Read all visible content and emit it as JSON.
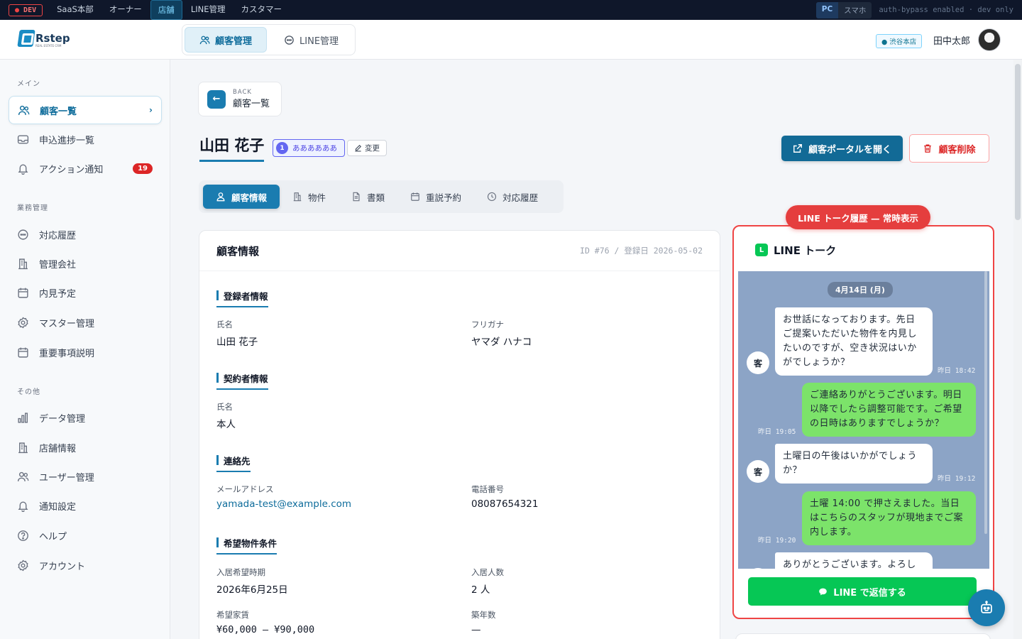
{
  "devbar": {
    "env": "DEV",
    "nav": [
      "SaaS本部",
      "オーナー",
      "店舗",
      "LINE管理",
      "カスタマー"
    ],
    "active_nav": "店舗",
    "view_pc": "PC",
    "view_sp": "スマホ",
    "note": "auth-bypass enabled · dev only"
  },
  "header": {
    "logo": "Rstep",
    "logo_sub": "REAL ESTATE CRM",
    "tabs": [
      "顧客管理",
      "LINE管理"
    ],
    "store": "● 渋谷本店",
    "user": "田中太郎"
  },
  "sidebar": {
    "sections": [
      "メイン",
      "業務管理",
      "その他"
    ],
    "main_items": [
      {
        "label": "顧客一覧",
        "icon": "users-icon"
      },
      {
        "label": "申込進捗一覧",
        "icon": "inbox-icon"
      },
      {
        "label": "アクション通知",
        "icon": "bell-icon",
        "badge": "19"
      }
    ],
    "work_items": [
      {
        "label": "対応履歴",
        "icon": "chat-icon"
      },
      {
        "label": "管理会社",
        "icon": "building-icon"
      },
      {
        "label": "内見予定",
        "icon": "calendar-icon"
      },
      {
        "label": "マスター管理",
        "icon": "gear-icon"
      },
      {
        "label": "重要事項説明",
        "icon": "calendar-icon"
      }
    ],
    "other_items": [
      {
        "label": "データ管理",
        "icon": "bar-chart-icon"
      },
      {
        "label": "店舗情報",
        "icon": "building-icon"
      },
      {
        "label": "ユーザー管理",
        "icon": "users-icon"
      },
      {
        "label": "通知設定",
        "icon": "bell-icon"
      },
      {
        "label": "ヘルプ",
        "icon": "help-icon"
      },
      {
        "label": "アカウント",
        "icon": "gear-icon"
      }
    ]
  },
  "back": {
    "small": "BACK",
    "label": "顧客一覧"
  },
  "customer": {
    "name": "山田 花子",
    "rank_num": "1",
    "rank_label": "ああああああ",
    "change_label": "変更",
    "portal_button": "顧客ポータルを開く",
    "delete_button": "顧客削除"
  },
  "tabs": [
    "顧客情報",
    "物件",
    "書類",
    "重説予約",
    "対応履歴"
  ],
  "card": {
    "title": "顧客情報",
    "meta": "ID #76 / 登録日 2026-05-02",
    "registrant": {
      "heading": "登録者情報",
      "name_label": "氏名",
      "name": "山田 花子",
      "kana_label": "フリガナ",
      "kana": "ヤマダ ハナコ"
    },
    "contractor": {
      "heading": "契約者情報",
      "name_label": "氏名",
      "name": "本人"
    },
    "contact": {
      "heading": "連絡先",
      "email_label": "メールアドレス",
      "email": "yamada-test@example.com",
      "phone_label": "電話番号",
      "phone": "08087654321"
    },
    "wish": {
      "heading": "希望物件条件",
      "move_label": "入居希望時期",
      "move": "2026年6月25日",
      "people_label": "入居人数",
      "people": "2 人",
      "rent_label": "希望家賃",
      "rent": "¥60,000 — ¥90,000",
      "age_label": "築年数",
      "age": "—"
    }
  },
  "line": {
    "callout": "LINE トーク履歴 — 常時表示",
    "logo": "L",
    "title": "LINE トーク",
    "date": "4月14日 (月)",
    "avatar": "客",
    "messages": [
      {
        "dir": "in",
        "text": "お世話になっております。先日ご提案いただいた物件を内見したいのですが、空き状況はいかがでしょうか？",
        "time": "昨日 18:42"
      },
      {
        "dir": "out",
        "text": "ご連絡ありがとうございます。明日以降でしたら調整可能です。ご希望の日時はありますでしょうか？",
        "time": "昨日 19:05"
      },
      {
        "dir": "in",
        "text": "土曜日の午後はいかがでしょうか？",
        "time": "昨日 19:12"
      },
      {
        "dir": "out",
        "text": "土曜 14:00 で押さえました。当日はこちらのスタッフが現地までご案内します。",
        "time": "昨日 19:20"
      },
      {
        "dir": "in",
        "text": "ありがとうございます。よろしく",
        "time": ""
      }
    ],
    "reply_button": "LINE で返信する"
  }
}
